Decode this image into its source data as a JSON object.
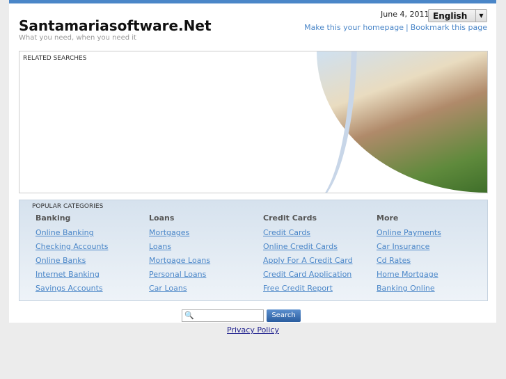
{
  "header": {
    "title": "Santamariasoftware.Net",
    "tagline": "What you need, when you need it",
    "date": "June 4, 2011",
    "language": "English",
    "make_homepage": "Make this your homepage",
    "separator": "|",
    "bookmark": "Bookmark this page"
  },
  "related": {
    "label": "RELATED SEARCHES"
  },
  "categories": {
    "label": "POPULAR CATEGORIES",
    "columns": [
      {
        "title": "Banking",
        "links": [
          "Online Banking",
          "Checking Accounts",
          "Online Banks",
          "Internet Banking",
          "Savings Accounts"
        ]
      },
      {
        "title": "Loans",
        "links": [
          "Mortgages",
          "Loans",
          "Mortgage Loans",
          "Personal Loans",
          "Car Loans"
        ]
      },
      {
        "title": "Credit Cards",
        "links": [
          "Credit Cards",
          "Online Credit Cards",
          "Apply For A Credit Card",
          "Credit Card Application",
          "Free Credit Report"
        ]
      },
      {
        "title": "More",
        "links": [
          "Online Payments",
          "Car Insurance",
          "Cd Rates",
          "Home Mortgage",
          "Banking Online"
        ]
      }
    ]
  },
  "search": {
    "value": "",
    "button": "Search"
  },
  "footer": {
    "privacy": "Privacy Policy"
  }
}
